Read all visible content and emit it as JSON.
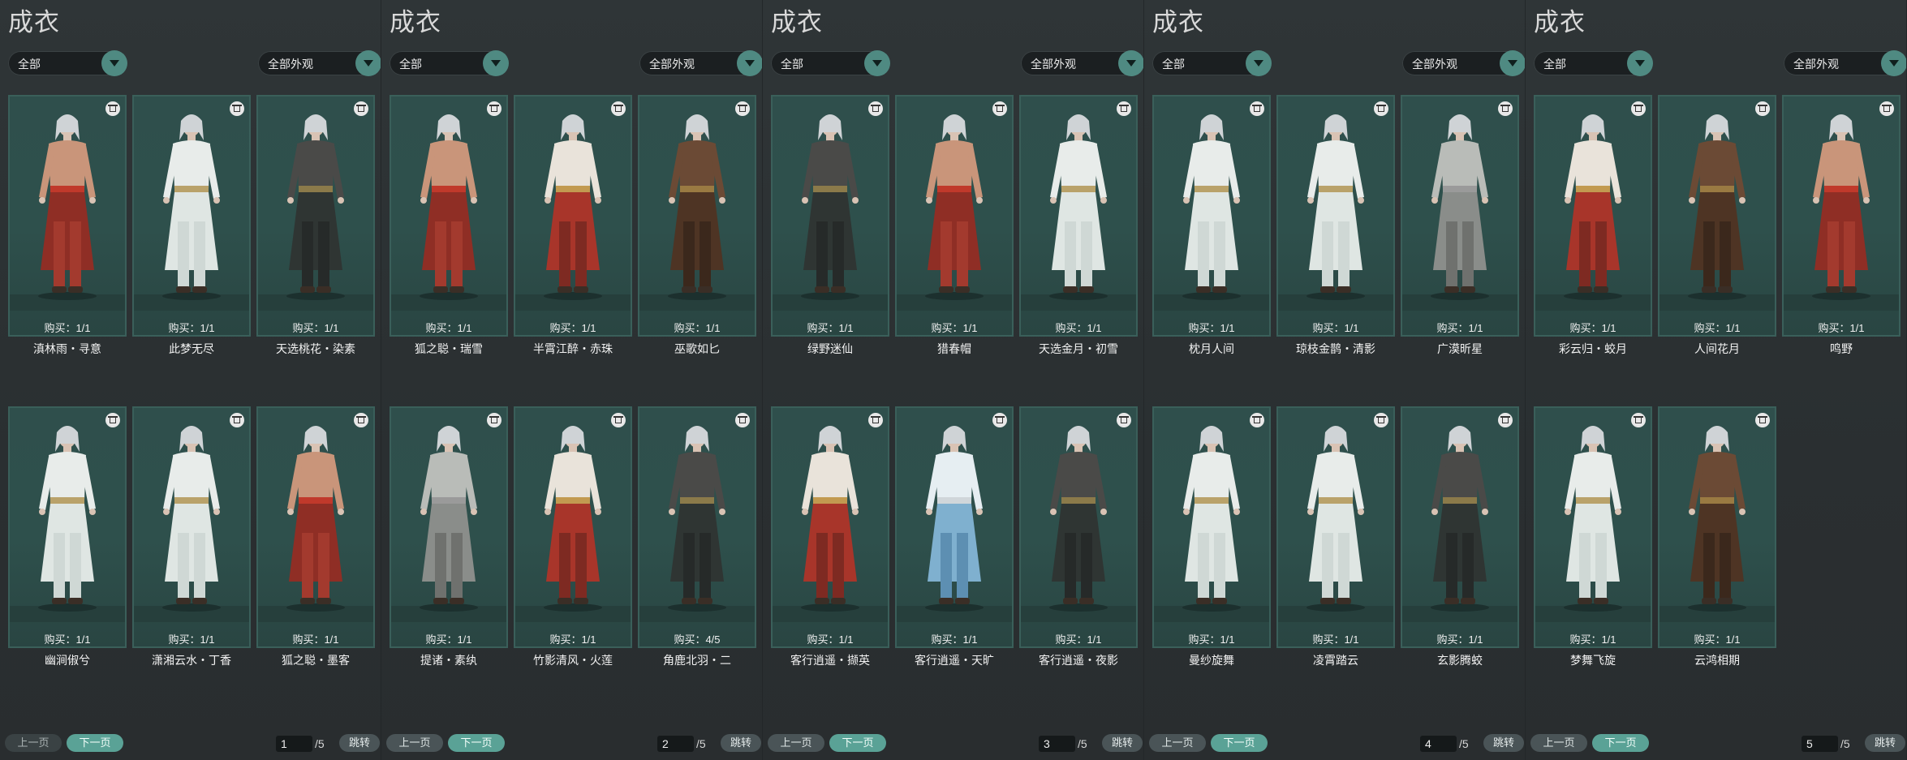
{
  "colors": {
    "card_bg": "#2e504c",
    "card_border": "#3a5f5a",
    "accent": "#5aa296",
    "panel_bg": "#2b3032"
  },
  "panels": [
    {
      "title": "成衣",
      "filter": "全部",
      "appearance": "全部外观",
      "items": [
        {
          "name": "滇林雨・寻意",
          "buy": "购买：1/1",
          "outfit": "bare"
        },
        {
          "name": "此梦无尽",
          "buy": "购买：1/1",
          "outfit": "white"
        },
        {
          "name": "天选桃花・染素",
          "buy": "购买：1/1",
          "outfit": "dark"
        },
        {
          "name": "幽涧俶兮",
          "buy": "购买：1/1",
          "outfit": "white"
        },
        {
          "name": "潇湘云水・丁香",
          "buy": "购买：1/1",
          "outfit": "white"
        },
        {
          "name": "狐之聪・墨客",
          "buy": "购买：1/1",
          "outfit": "bare"
        }
      ],
      "pager": {
        "prev": "上一页",
        "next": "下一页",
        "page": "1",
        "total": "/5",
        "jump": "跳转",
        "prev_disabled": true
      }
    },
    {
      "title": "成衣",
      "filter": "全部",
      "appearance": "全部外观",
      "items": [
        {
          "name": "狐之聪・瑞雪",
          "buy": "购买：1/1",
          "outfit": "bare"
        },
        {
          "name": "半霄江醉・赤珠",
          "buy": "购买：1/1",
          "outfit": "red"
        },
        {
          "name": "巫歌如匕",
          "buy": "购买：1/1",
          "outfit": "brown"
        },
        {
          "name": "提诸・素纨",
          "buy": "购买：1/1",
          "outfit": "grey"
        },
        {
          "name": "竹影清风・火莲",
          "buy": "购买：1/1",
          "outfit": "red"
        },
        {
          "name": "角鹿北羽・二",
          "buy": "购买：4/5",
          "outfit": "dark"
        }
      ],
      "pager": {
        "prev": "上一页",
        "next": "下一页",
        "page": "2",
        "total": "/5",
        "jump": "跳转",
        "prev_disabled": false
      }
    },
    {
      "title": "成衣",
      "filter": "全部",
      "appearance": "全部外观",
      "items": [
        {
          "name": "绿野迷仙",
          "buy": "购买：1/1",
          "outfit": "dark"
        },
        {
          "name": "猎春帽",
          "buy": "购买：1/1",
          "outfit": "bare"
        },
        {
          "name": "天选金月・初雪",
          "buy": "购买：1/1",
          "outfit": "white"
        },
        {
          "name": "客行逍遥・撷英",
          "buy": "购买：1/1",
          "outfit": "red"
        },
        {
          "name": "客行逍遥・天旷",
          "buy": "购买：1/1",
          "outfit": "blue"
        },
        {
          "name": "客行逍遥・夜影",
          "buy": "购买：1/1",
          "outfit": "dark"
        }
      ],
      "pager": {
        "prev": "上一页",
        "next": "下一页",
        "page": "3",
        "total": "/5",
        "jump": "跳转",
        "prev_disabled": false
      }
    },
    {
      "title": "成衣",
      "filter": "全部",
      "appearance": "全部外观",
      "items": [
        {
          "name": "枕月人间",
          "buy": "购买：1/1",
          "outfit": "white"
        },
        {
          "name": "琼枝金鹊・清影",
          "buy": "购买：1/1",
          "outfit": "white"
        },
        {
          "name": "广漠昕星",
          "buy": "购买：1/1",
          "outfit": "grey"
        },
        {
          "name": "曼纱旋舞",
          "buy": "购买：1/1",
          "outfit": "white"
        },
        {
          "name": "凌霄踏云",
          "buy": "购买：1/1",
          "outfit": "white"
        },
        {
          "name": "玄影腾蛟",
          "buy": "购买：1/1",
          "outfit": "dark"
        }
      ],
      "pager": {
        "prev": "上一页",
        "next": "下一页",
        "page": "4",
        "total": "/5",
        "jump": "跳转",
        "prev_disabled": false
      }
    },
    {
      "title": "成衣",
      "filter": "全部",
      "appearance": "全部外观",
      "items": [
        {
          "name": "彩云归・蛟月",
          "buy": "购买：1/1",
          "outfit": "red"
        },
        {
          "name": "人间花月",
          "buy": "购买：1/1",
          "outfit": "brown"
        },
        {
          "name": "鸣野",
          "buy": "购买：1/1",
          "outfit": "bare"
        },
        {
          "name": "梦舞飞旋",
          "buy": "购买：1/1",
          "outfit": "white"
        },
        {
          "name": "云鸿相期",
          "buy": "购买：1/1",
          "outfit": "brown"
        }
      ],
      "pager": {
        "prev": "上一页",
        "next": "下一页",
        "page": "5",
        "total": "/5",
        "jump": "跳转",
        "prev_disabled": false
      }
    }
  ]
}
